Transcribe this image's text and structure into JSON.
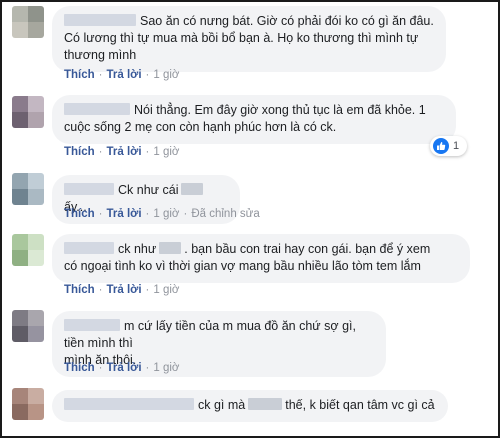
{
  "actions": {
    "like": "Thích",
    "reply": "Trả lời",
    "separator": "·"
  },
  "comments": [
    {
      "text_lines": [
        "Sao ăn có nưng bát. Giờ có phải đói ko có gì ăn đâu.",
        "Có lương thì tự mua mà bồi bổ bạn à. Họ ko thương thì mình tự",
        "thương mình"
      ],
      "time": "1 giờ",
      "avatar_colors": [
        "#b5b7ae",
        "#8f938b",
        "#c8c6bd",
        "#a6a79e"
      ]
    },
    {
      "text_lines": [
        "Nói thẳng. Em đây giờ xong thủ tục là em đã khỏe. 1",
        "cuộc sống 2 mẹ con còn hạnh phúc hơn là có ck."
      ],
      "time": "1 giờ",
      "avatar_colors": [
        "#8a7b8c",
        "#c3b7c2",
        "#6d6170",
        "#b0a3ad"
      ],
      "reaction_count": "1"
    },
    {
      "text_before": "Ck như cái",
      "text_after": "ấy...",
      "time": "1 giờ",
      "edited": "Đã chỉnh sửa",
      "avatar_colors": [
        "#93a5b0",
        "#c0cdd6",
        "#6f8390",
        "#aab9c3"
      ]
    },
    {
      "line1_before": "ck như",
      "line1_after": ". bạn bầu con trai hay con gái. bạn để ý xem",
      "line2": "có ngoại tình ko vì thời gian vợ mang bầu nhiều lão tòm tem lắm",
      "time": "1 giờ",
      "avatar_colors": [
        "#a9c79d",
        "#cde0c4",
        "#8fb083",
        "#dbe9d4"
      ]
    },
    {
      "text_lines": [
        "m cứ lấy tiền của m mua đồ ăn chứ sợ gì, tiền mình thì",
        "mình ăn thôi."
      ],
      "time": "1 giờ",
      "avatar_colors": [
        "#7e7b84",
        "#a9a6ad",
        "#5f5c66",
        "#9693a0"
      ]
    },
    {
      "text_before": "ck gì mà",
      "text_after": "thế, k biết qan tâm vc gì cả",
      "avatar_colors": [
        "#a7857a",
        "#c9ada2",
        "#8a6a60",
        "#b89486"
      ]
    }
  ]
}
